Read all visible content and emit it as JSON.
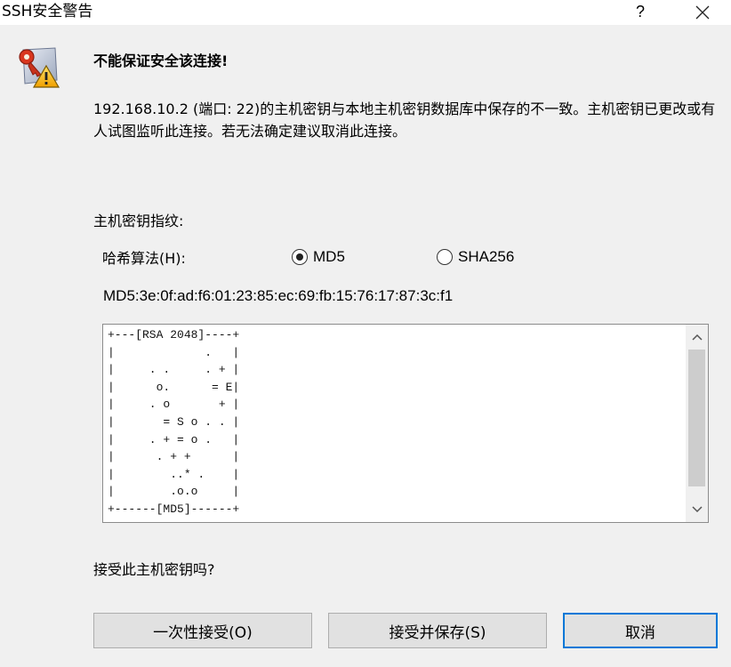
{
  "window": {
    "title": "SSH安全警告",
    "help_glyph": "?"
  },
  "icons": {
    "warning": "key-warning-icon",
    "close": "close-icon"
  },
  "headline": "不能保证安全该连接!",
  "message": "192.168.10.2 (端口: 22)的主机密钥与本地主机密钥数据库中保存的不一致。主机密钥已更改或有人试图监听此连接。若无法确定建议取消此连接。",
  "fingerprint": {
    "label": "主机密钥指纹:",
    "hash_label": "哈希算法(H):",
    "options": [
      {
        "label": "MD5",
        "checked": true
      },
      {
        "label": "SHA256",
        "checked": false
      }
    ],
    "value": "MD5:3e:0f:ad:f6:01:23:85:ec:69:fb:15:76:17:87:3c:f1",
    "randomart": "+---[RSA 2048]----+\n|             .   |\n|     . .     . + |\n|      o.      = E|\n|     . o       + |\n|       = S o . . |\n|     . + = o .   |\n|      . + +      |\n|        ..* .    |\n|        .o.o     |\n+------[MD5]------+"
  },
  "question": "接受此主机密钥吗?",
  "buttons": {
    "accept_once": "一次性接受(O)",
    "accept_save": "接受并保存(S)",
    "cancel": "取消"
  }
}
